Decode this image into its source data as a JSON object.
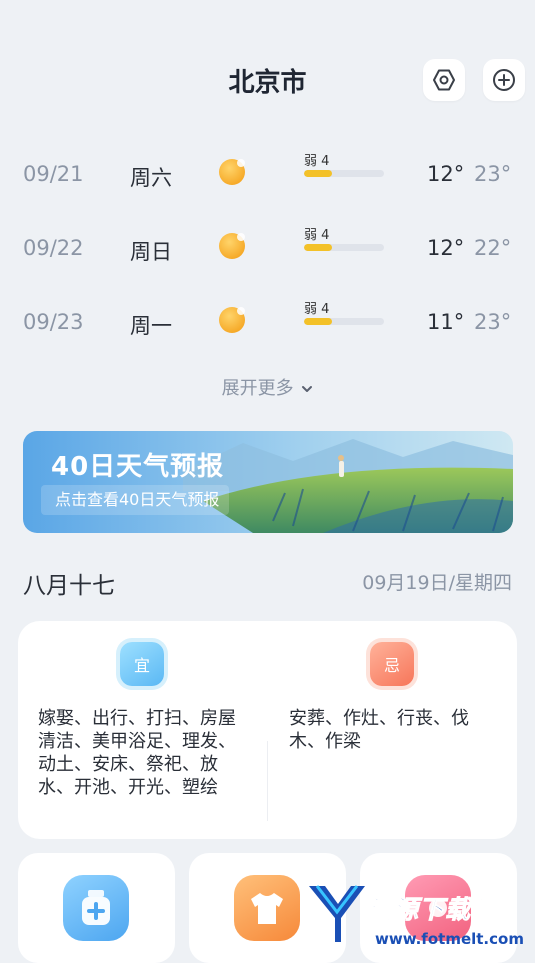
{
  "header": {
    "city": "北京市"
  },
  "forecast": [
    {
      "date": "09/21",
      "weekday": "周六",
      "aqi_label": "弱 4",
      "aqi_level": 0.35,
      "low": "12°",
      "high": "23°"
    },
    {
      "date": "09/22",
      "weekday": "周日",
      "aqi_label": "弱 4",
      "aqi_level": 0.35,
      "low": "12°",
      "high": "22°"
    },
    {
      "date": "09/23",
      "weekday": "周一",
      "aqi_label": "弱 4",
      "aqi_level": 0.35,
      "low": "11°",
      "high": "23°"
    }
  ],
  "expand_label": "展开更多",
  "banner": {
    "title": "40日天气预报",
    "subtitle": "点击查看40日天气预报"
  },
  "calendar": {
    "lunar": "八月十七",
    "solar": "09月19日/星期四"
  },
  "almanac": {
    "good_tag": "宜",
    "good_text": "嫁娶、出行、打扫、房屋清洁、美甲浴足、理发、动土、安床、祭祀、放水、开池、开光、塑绘",
    "bad_tag": "忌",
    "bad_text": "安葬、作灶、行丧、伐木、作梁"
  },
  "cards": [
    {
      "icon": "medicine-bottle-icon"
    },
    {
      "icon": "shirt-icon"
    },
    {
      "icon": "pink-icon"
    }
  ],
  "watermark": {
    "text": "清源下载站",
    "url": "www.fotmelt.com"
  },
  "colors": {
    "aqi_fill": "#f3c128",
    "accent_blue": "#5ab8f4",
    "accent_red": "#f7765a"
  }
}
